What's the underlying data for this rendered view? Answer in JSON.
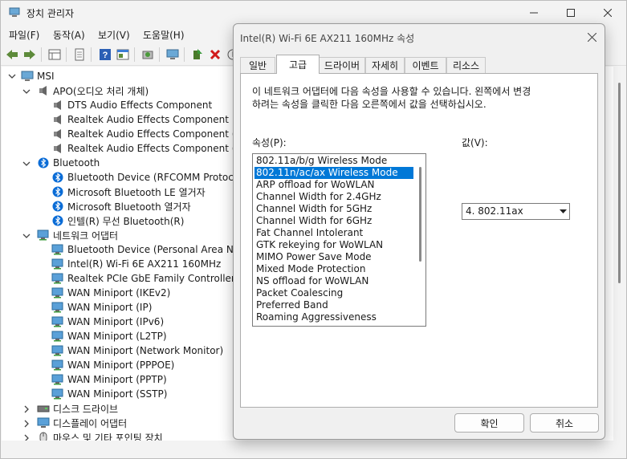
{
  "window": {
    "title": "장치 관리자",
    "menu": [
      "파일(F)",
      "동작(A)",
      "보기(V)",
      "도움말(H)"
    ]
  },
  "tree": {
    "root": "MSI",
    "rows": [
      {
        "label": "APO(오디오 처리 개체)",
        "level": 1,
        "expander": "expanded",
        "icon": "speaker-icon"
      },
      {
        "label": "DTS Audio Effects Component",
        "level": 2,
        "icon": "speaker-icon"
      },
      {
        "label": "Realtek Audio Effects Component",
        "level": 2,
        "icon": "speaker-icon"
      },
      {
        "label": "Realtek Audio Effects Component (INT",
        "level": 2,
        "icon": "speaker-icon"
      },
      {
        "label": "Realtek Audio Effects Component (INT",
        "level": 2,
        "icon": "speaker-icon"
      },
      {
        "label": "Bluetooth",
        "level": 1,
        "expander": "expanded",
        "icon": "bluetooth-icon"
      },
      {
        "label": "Bluetooth Device (RFCOMM Protocol T",
        "level": 2,
        "icon": "bluetooth-icon"
      },
      {
        "label": "Microsoft Bluetooth LE 열거자",
        "level": 2,
        "icon": "bluetooth-icon"
      },
      {
        "label": "Microsoft Bluetooth 열거자",
        "level": 2,
        "icon": "bluetooth-icon"
      },
      {
        "label": "인텔(R) 무선 Bluetooth(R)",
        "level": 2,
        "icon": "bluetooth-icon"
      },
      {
        "label": "네트워크 어댑터",
        "level": 1,
        "expander": "expanded",
        "icon": "network-adapter-icon"
      },
      {
        "label": "Bluetooth Device (Personal Area Netw",
        "level": 2,
        "icon": "network-adapter-icon"
      },
      {
        "label": "Intel(R) Wi-Fi 6E AX211 160MHz",
        "level": 2,
        "icon": "network-adapter-icon"
      },
      {
        "label": "Realtek PCIe GbE Family Controller",
        "level": 2,
        "icon": "network-adapter-icon"
      },
      {
        "label": "WAN Miniport (IKEv2)",
        "level": 2,
        "icon": "network-adapter-icon"
      },
      {
        "label": "WAN Miniport (IP)",
        "level": 2,
        "icon": "network-adapter-icon"
      },
      {
        "label": "WAN Miniport (IPv6)",
        "level": 2,
        "icon": "network-adapter-icon"
      },
      {
        "label": "WAN Miniport (L2TP)",
        "level": 2,
        "icon": "network-adapter-icon"
      },
      {
        "label": "WAN Miniport (Network Monitor)",
        "level": 2,
        "icon": "network-adapter-icon"
      },
      {
        "label": "WAN Miniport (PPPOE)",
        "level": 2,
        "icon": "network-adapter-icon"
      },
      {
        "label": "WAN Miniport (PPTP)",
        "level": 2,
        "icon": "network-adapter-icon"
      },
      {
        "label": "WAN Miniport (SSTP)",
        "level": 2,
        "icon": "network-adapter-icon"
      },
      {
        "label": "디스크 드라이브",
        "level": 1,
        "expander": "collapsed",
        "icon": "disk-drive-icon"
      },
      {
        "label": "디스플레이 어댑터",
        "level": 1,
        "expander": "collapsed",
        "icon": "display-adapter-icon"
      },
      {
        "label": "마우스 및 기타 포인팅 장치",
        "level": 1,
        "expander": "collapsed",
        "icon": "mouse-icon"
      }
    ]
  },
  "dialog": {
    "title": "Intel(R) Wi-Fi 6E AX211 160MHz 속성",
    "tabs": [
      "일반",
      "고급",
      "드라이버",
      "자세히",
      "이벤트",
      "리소스"
    ],
    "active_tab": "고급",
    "description_line1": "이 네트워크 어댑터에 다음 속성을 사용할 수 있습니다. 왼쪽에서 변경",
    "description_line2": "하려는 속성을 클릭한 다음 오른쪽에서 값을 선택하십시오.",
    "property_label": "속성(P):",
    "value_label": "값(V):",
    "properties": [
      "802.11a/b/g Wireless Mode",
      "802.11n/ac/ax Wireless Mode",
      "ARP offload for WoWLAN",
      "Channel Width for 2.4GHz",
      "Channel Width for 5GHz",
      "Channel Width for 6GHz",
      "Fat Channel Intolerant",
      "GTK rekeying for WoWLAN",
      "MIMO Power Save Mode",
      "Mixed Mode Protection",
      "NS offload for WoWLAN",
      "Packet Coalescing",
      "Preferred Band",
      "Roaming Aggressiveness"
    ],
    "selected_property": "802.11n/ac/ax Wireless Mode",
    "value": "4. 802.11ax",
    "ok_label": "확인",
    "cancel_label": "취소"
  },
  "colors": {
    "selection": "#0078d7",
    "bluetooth": "#0a6cd6",
    "network": "#2a86c9",
    "delete_red": "#d11a1a"
  }
}
